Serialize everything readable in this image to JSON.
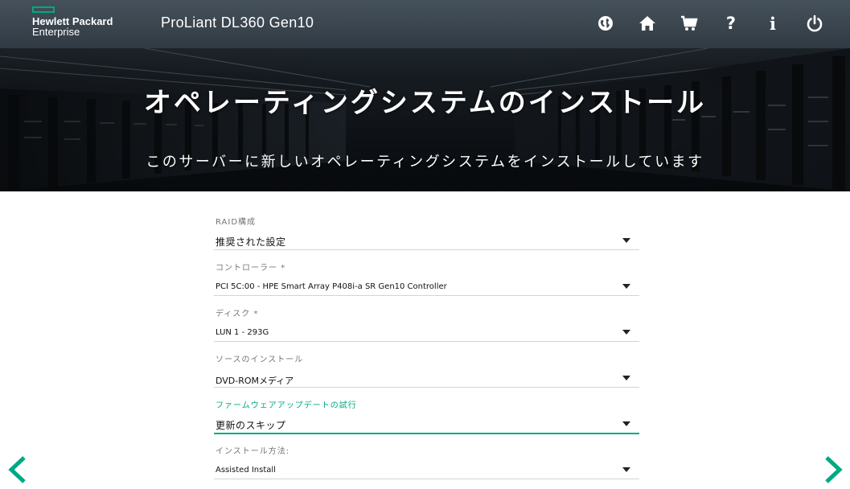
{
  "header": {
    "logo_line1": "Hewlett Packard",
    "logo_line2": "Enterprise",
    "product_name": "ProLiant DL360 Gen10",
    "icons": [
      "globe-icon",
      "home-icon",
      "cart-icon",
      "help-icon",
      "info-icon",
      "power-icon"
    ],
    "help_glyph": "?",
    "info_glyph": "i"
  },
  "hero": {
    "title": "オペレーティングシステムのインストール",
    "subtitle": "このサーバーに新しいオペレーティングシステムをインストールしています"
  },
  "form": {
    "fields": [
      {
        "label": "RAID構成",
        "value": "推奨された設定"
      },
      {
        "label": "コントローラー *",
        "value": "PCI 5C:00 - HPE Smart Array P408i-a SR Gen10 Controller"
      },
      {
        "label": "ディスク *",
        "value": "LUN 1 - 293G"
      },
      {
        "label": "ソースのインストール",
        "value": "DVD-ROMメディア"
      },
      {
        "label": "ファームウェアアップデートの試行",
        "value": "更新のスキップ"
      },
      {
        "label": "インストール方法:",
        "value": "Assisted Install"
      }
    ]
  },
  "nav": {
    "prev_icon": "chevron-left-icon",
    "next_icon": "chevron-right-icon"
  },
  "colors": {
    "accent": "#01a982",
    "header_text": "#ffffff",
    "label": "#757575",
    "divider": "#d3d3d3"
  }
}
